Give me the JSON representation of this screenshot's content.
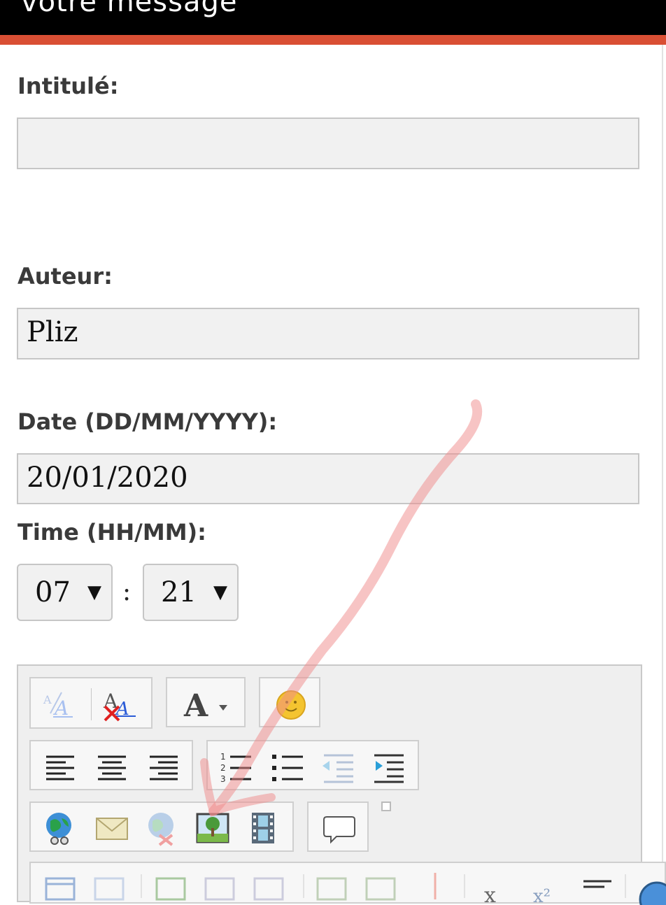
{
  "header": {
    "title": "votre message"
  },
  "form": {
    "intitule_label": "Intitulé:",
    "intitule_value": "",
    "auteur_label": "Auteur:",
    "auteur_value": "Pliz",
    "date_label": "Date (DD/MM/YYYY):",
    "date_value": "20/01/2020",
    "time_label": "Time (HH/MM):",
    "hour_value": "07",
    "minute_value": "21",
    "time_separator": ":",
    "dropdown_arrow": "▼"
  },
  "colors": {
    "accent": "#d94f34",
    "header_bg": "#000000",
    "annotation_arrow": "#f08a8a"
  },
  "toolbar": {
    "row1": [
      "font-size-icon",
      "remove-format-icon",
      "font-color-icon",
      "emoji-icon"
    ],
    "row2": [
      "align-left-icon",
      "align-center-icon",
      "align-right-icon",
      "ordered-list-icon",
      "unordered-list-icon",
      "outdent-icon",
      "indent-icon"
    ],
    "row3": [
      "link-icon",
      "email-icon",
      "unlink-icon",
      "image-icon",
      "video-icon",
      "quote-icon"
    ]
  },
  "toolbar_glyphs": {
    "text_A": "A",
    "font_A": "A",
    "small_a": "A",
    "strike_a": "A"
  }
}
